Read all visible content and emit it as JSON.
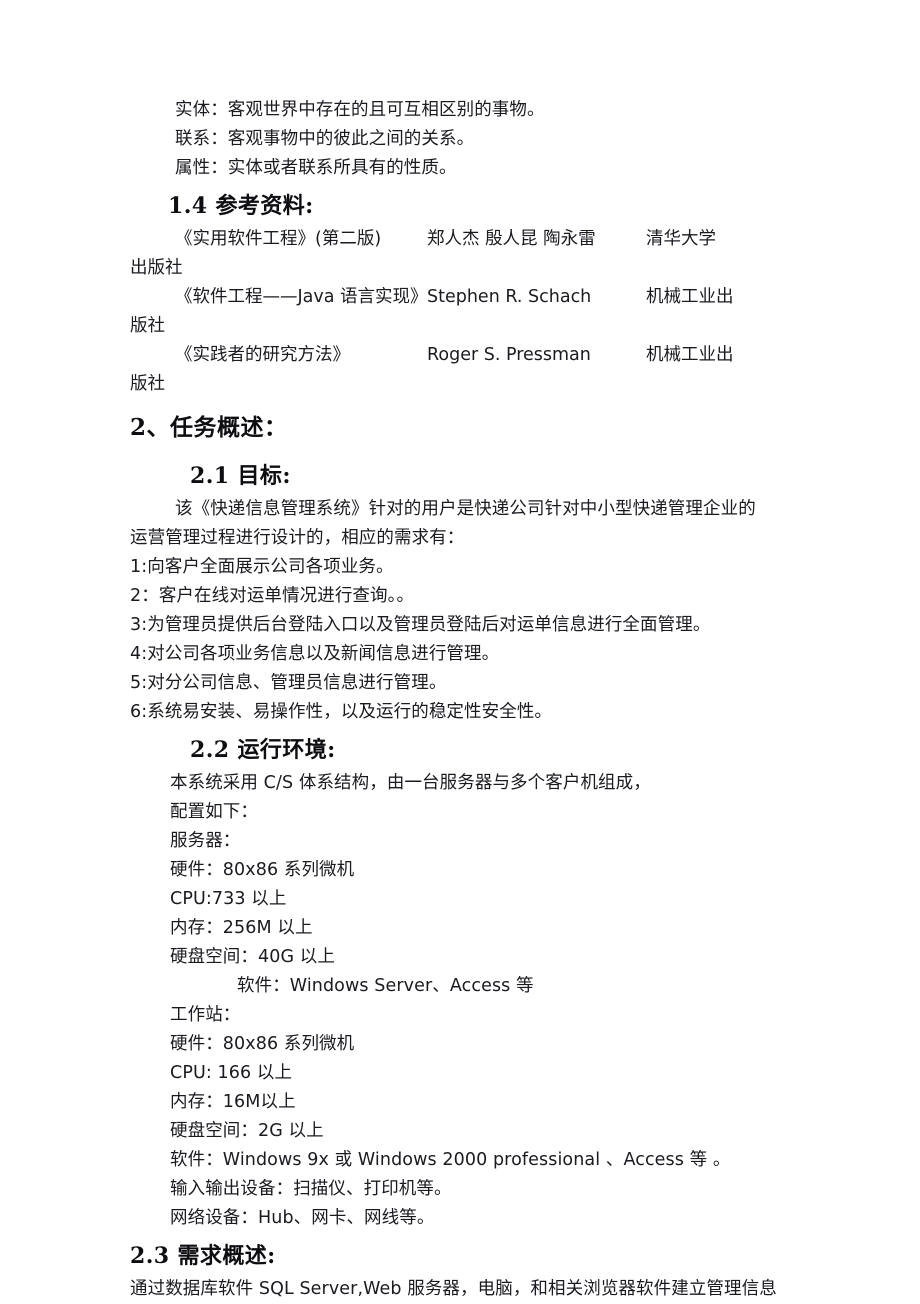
{
  "document": {
    "definitions": [
      "实体：客观世界中存在的且可互相区别的事物。",
      "联系：客观事物中的彼此之间的关系。",
      "属性：实体或者联系所具有的性质。"
    ],
    "section_1_4": {
      "heading": "1.4  参考资料:",
      "references": [
        {
          "title": "《实用软件工程》(第二版)",
          "author": "郑人杰   殷人昆   陶永雷",
          "publisher_head": "清华大学",
          "publisher_tail": "出版社"
        },
        {
          "title": "《软件工程——Java 语言实现》",
          "author": "Stephen R. Schach",
          "publisher_head": "机械工业出",
          "publisher_tail": "版社"
        },
        {
          "title": "《实践者的研究方法》",
          "author": "Roger S. Pressman",
          "publisher_head": "机械工业出",
          "publisher_tail": "版社"
        }
      ]
    },
    "section_2": {
      "heading": "2、任务概述：",
      "section_2_1": {
        "heading": "2.1 目标:",
        "intro_line_1": "该《快递信息管理系统》针对的用户是快递公司针对中小型快递管理企业的",
        "intro_line_2": "运营管理过程进行设计的，相应的需求有：",
        "requirements": [
          "1:向客户全面展示公司各项业务。",
          "2：客户在线对运单情况进行查询。。",
          "3:为管理员提供后台登陆入口以及管理员登陆后对运单信息进行全面管理。",
          "4:对公司各项业务信息以及新闻信息进行管理。",
          "5:对分公司信息、管理员信息进行管理。",
          "6:系统易安装、易操作性，以及运行的稳定性安全性。"
        ]
      },
      "section_2_2": {
        "heading": "2.2 运行环境:",
        "intro_line_1": "本系统采用 C/S 体系结构，由一台服务器与多个客户机组成，",
        "intro_line_2": "配置如下：",
        "server_label": "服务器：",
        "server_specs": [
          "硬件：80x86 系列微机",
          "CPU:733 以上",
          "内存：256M 以上",
          "硬盘空间：40G 以上"
        ],
        "server_software": "软件：Windows Server、Access 等",
        "workstation_label": "工作站：",
        "workstation_specs": [
          "硬件：80x86 系列微机",
          "CPU: 166 以上",
          "内存：16M以上",
          "硬盘空间：2G 以上",
          "软件：Windows 9x 或 Windows 2000 professional 、Access 等 。",
          "输入输出设备：扫描仪、打印机等。",
          "网络设备：Hub、网卡、网线等。"
        ]
      },
      "section_2_3": {
        "heading": "2.3 需求概述:",
        "body_line_1": "通过数据库软件 SQL Server,Web 服务器，电脑，和相关浏览器软件建立管理信息"
      }
    }
  }
}
